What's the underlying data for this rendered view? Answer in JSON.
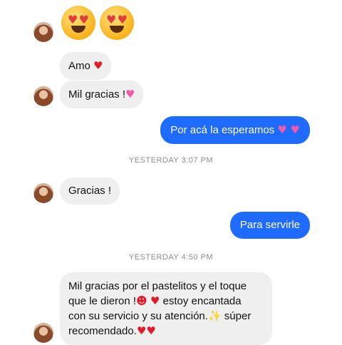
{
  "messages": {
    "m1_text": "Amo",
    "m2_text": "Mil gracias !",
    "m3_text": "Por acá la esperamos",
    "m4_text": "Gracias !",
    "m5_text": "Para servirle",
    "m6_line1": "Mil gracias por el pastelitos y el toque",
    "m6_line2a": "que le dieron !",
    "m6_line2b": "estoy encantada",
    "m6_line3a": "con su servicio y su atención.",
    "m6_line3b": "súper",
    "m6_line4": "recomendado."
  },
  "timestamps": {
    "t1": "YESTERDAY 3:07 PM",
    "t2": "YESTERDAY 4:50 PM"
  },
  "icons": {
    "heart_eyes": "heart-eyes-emoji",
    "red_heart": "red-heart-emoji",
    "pink_heart": "sparkling-heart-emoji",
    "two_hearts": "two-hearts-emoji",
    "sparkles": "sparkles-emoji"
  },
  "colors": {
    "outgoing_bubble": "#1f6bff",
    "incoming_bubble": "#efefef",
    "timestamp_text": "#8e8e8e"
  }
}
